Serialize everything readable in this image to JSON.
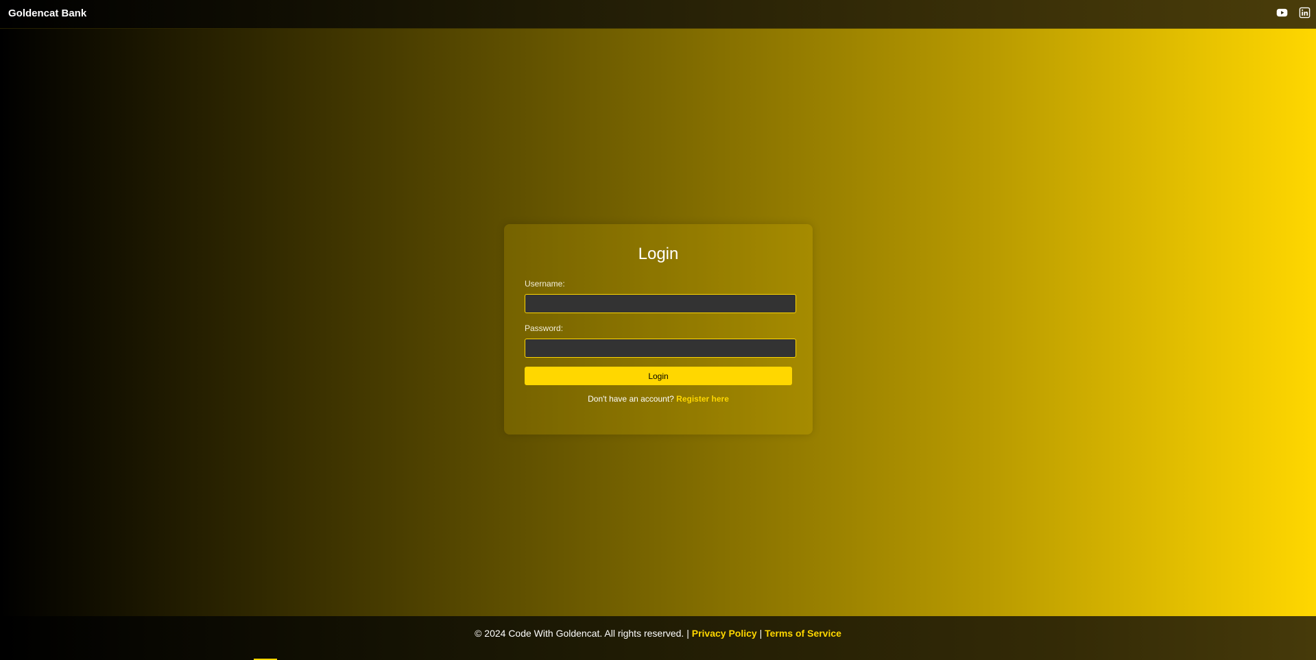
{
  "header": {
    "brand": "Goldencat Bank",
    "social_icons": [
      "youtube-icon",
      "linkedin-icon"
    ]
  },
  "login": {
    "title": "Login",
    "username_label": "Username:",
    "username_value": "",
    "password_label": "Password:",
    "password_value": "",
    "submit_label": "Login",
    "register_prompt": "Don't have an account?",
    "register_link": "Register here"
  },
  "footer": {
    "copyright": "© 2024 Code With Goldencat. All rights reserved. |",
    "privacy_link": "Privacy Policy",
    "separator": "|",
    "terms_link": "Terms of Service"
  },
  "colors": {
    "accent": "#ffd700",
    "input_bg": "#333333",
    "text": "#ffffff"
  }
}
